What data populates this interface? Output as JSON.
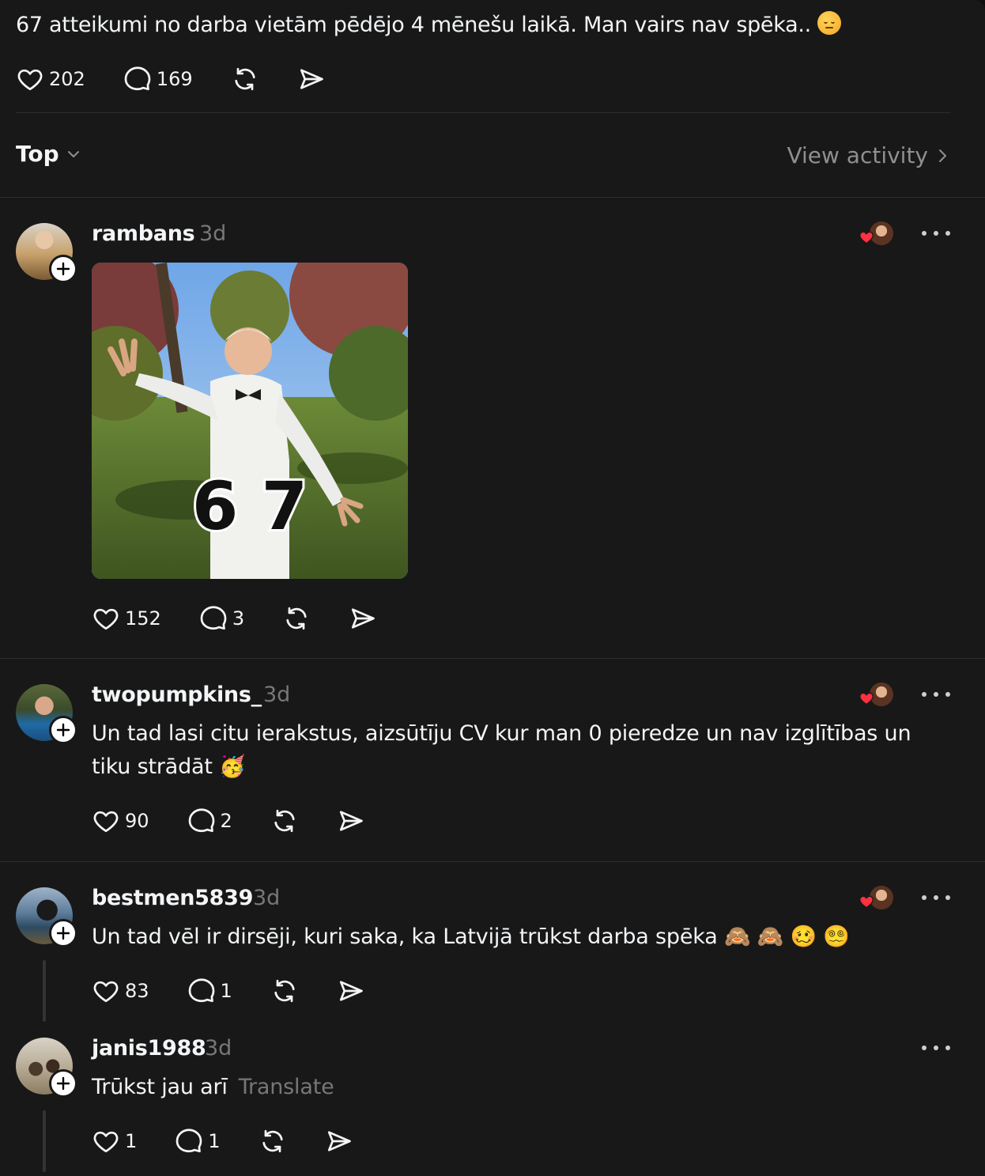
{
  "post": {
    "text": "67 atteikumi no darba vietām pēdējo 4 mēnešu laikā. Man vairs nav spēka..",
    "emoji": "pensive-face",
    "likes": "202",
    "comments": "169"
  },
  "sort": {
    "label": "Top",
    "view_activity": "View activity"
  },
  "replies": [
    {
      "username": "rambans",
      "time": "3d",
      "media": {
        "overlay_text": "6 7"
      },
      "likes": "152",
      "comments": "3"
    },
    {
      "username": "twopumpkins_",
      "time": "3d",
      "text": "Un tad lasi citu ierakstus, aizsūtīju CV kur man 0 pieredze un nav izglītības un tiku strādāt 🥳",
      "likes": "90",
      "comments": "2"
    },
    {
      "username": "bestmen5839",
      "time": "3d",
      "text": "Un tad vēl ir dirsēji, kuri saka, ka Latvijā trūkst darba spēka 🙈 🙈 🥴 😵‍💫",
      "likes": "83",
      "comments": "1"
    },
    {
      "username": "janis1988",
      "time": "3d",
      "text": "Trūkst jau arī",
      "translate": "Translate",
      "likes": "1",
      "comments": "1"
    }
  ],
  "colors": {
    "background": "#181818",
    "text": "#f3f5f7",
    "muted": "#777777",
    "liked_heart": "#ff3040"
  }
}
